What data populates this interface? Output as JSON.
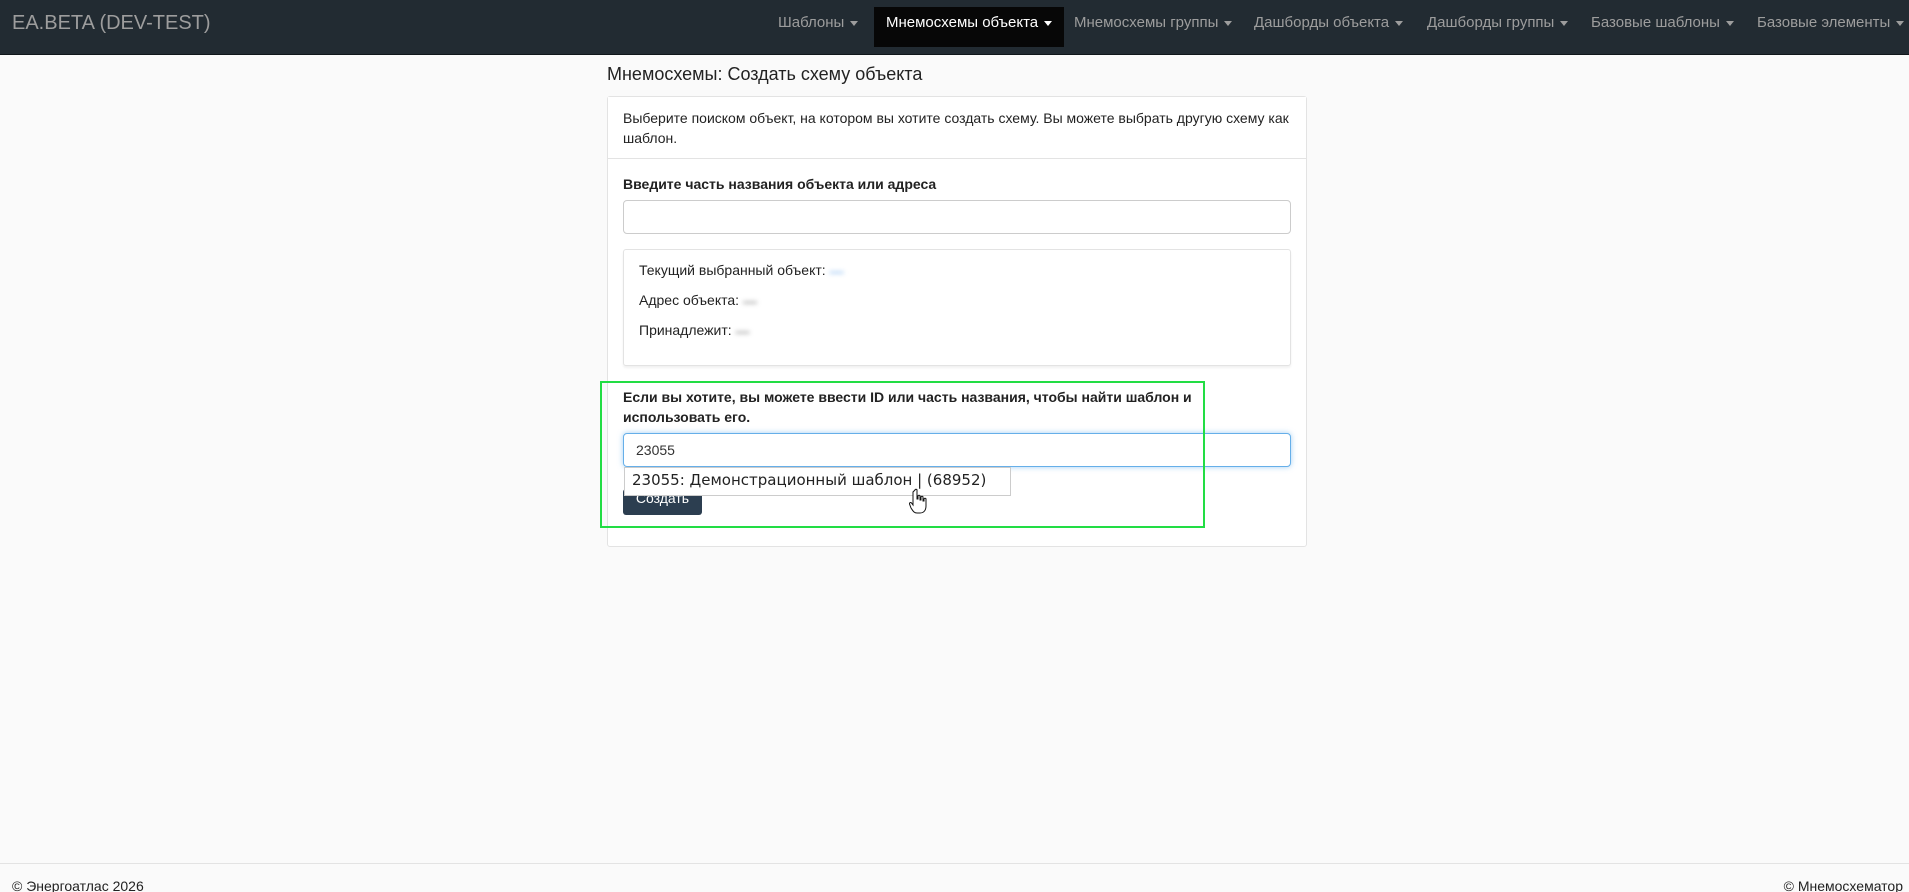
{
  "app": {
    "brand": "EA.BETA (DEV-TEST)"
  },
  "nav": {
    "items": [
      {
        "label": "Шаблоны",
        "active": false
      },
      {
        "label": "Мнемосхемы объекта",
        "active": true
      },
      {
        "label": "Мнемосхемы группы",
        "active": false
      },
      {
        "label": "Дашборды объекта",
        "active": false
      },
      {
        "label": "Дашборды группы",
        "active": false
      },
      {
        "label": "Базовые шаблоны",
        "active": false
      },
      {
        "label": "Базовые элементы",
        "active": false
      }
    ]
  },
  "page": {
    "title": "Мнемосхемы: Создать схему объекта"
  },
  "panel": {
    "intro": "Выберите поиском объект, на котором вы хотите создать схему. Вы можете выбрать другую схему как шаблон.",
    "object_search": {
      "label": "Введите часть названия объекта или адреса",
      "value": ""
    },
    "selected": {
      "current_label": "Текущий выбранный объект:",
      "current_value": "—",
      "address_label": "Адрес объекта:",
      "address_value": "—",
      "owner_label": "Принадлежит:",
      "owner_value": "—"
    },
    "template_search": {
      "label": "Если вы хотите, вы можете ввести ID или часть названия, чтобы найти шаблон и использовать его.",
      "value": "23055"
    },
    "suggestion": "23055: Демонстрационный шаблон | (68952)",
    "create_button": "Создать"
  },
  "footer": {
    "left": "© Энергоатлас 2026",
    "right": "© Мнемосхематор"
  },
  "colors": {
    "navbar": "#222b32",
    "active_nav": "#070707",
    "highlight": "#22dd44",
    "button": "#2c3e50",
    "link": "#3a8ee6"
  }
}
